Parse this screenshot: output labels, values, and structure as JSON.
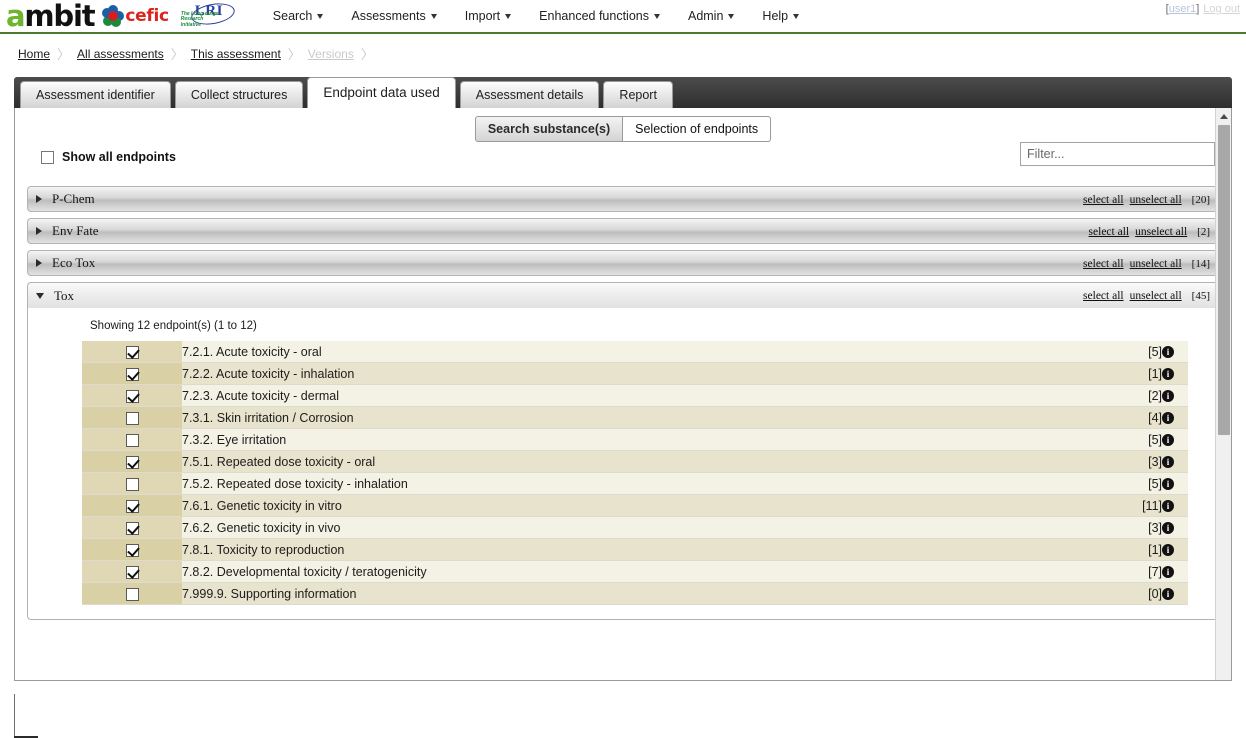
{
  "header": {
    "logo": {
      "brand": "ambit",
      "brand_first_letter": "a",
      "partner1": "cefic",
      "partner2": "LRI",
      "partner2_sub": "The Long-range Research Initiative"
    },
    "nav": [
      {
        "label": "Search",
        "has_caret": true
      },
      {
        "label": "Assessments",
        "has_caret": true
      },
      {
        "label": "Import",
        "has_caret": true
      },
      {
        "label": "Enhanced functions",
        "has_caret": true
      },
      {
        "label": "Admin",
        "has_caret": true
      },
      {
        "label": "Help",
        "has_caret": true
      }
    ],
    "user": {
      "bracket_open": "[",
      "name": "user1",
      "bracket_close": "]",
      "logout": "Log out"
    }
  },
  "breadcrumb": {
    "items": [
      {
        "label": "Home",
        "dim": false
      },
      {
        "label": "All assessments",
        "dim": false
      },
      {
        "label": "This assessment",
        "dim": false
      },
      {
        "label": "Versions",
        "dim": true
      }
    ],
    "separator": "〉"
  },
  "tabs": [
    {
      "label": "Assessment identifier",
      "active": false
    },
    {
      "label": "Collect structures",
      "active": false
    },
    {
      "label": "Endpoint data used",
      "active": true
    },
    {
      "label": "Assessment details",
      "active": false
    },
    {
      "label": "Report",
      "active": false
    }
  ],
  "subtabs": [
    {
      "label": "Search substance(s)",
      "active": false
    },
    {
      "label": "Selection of endpoints",
      "active": true
    }
  ],
  "controls": {
    "show_all_label": "Show all endpoints",
    "show_all_checked": false,
    "filter_placeholder": "Filter...",
    "filter_value": ""
  },
  "accordion_links": {
    "select_all": "select all",
    "unselect_all": "unselect all"
  },
  "accordions": [
    {
      "title": "P-Chem",
      "count": "[20]",
      "open": false
    },
    {
      "title": "Env Fate",
      "count": "[2]",
      "open": false
    },
    {
      "title": "Eco Tox",
      "count": "[14]",
      "open": false
    },
    {
      "title": "Tox",
      "count": "[45]",
      "open": true
    }
  ],
  "tox_panel": {
    "showing": "Showing 12 endpoint(s) (1 to 12)",
    "info_icon_glyph": "i",
    "rows": [
      {
        "checked": true,
        "label": "7.2.1. Acute toxicity - oral",
        "count": "[5]"
      },
      {
        "checked": true,
        "label": "7.2.2. Acute toxicity - inhalation",
        "count": "[1]"
      },
      {
        "checked": true,
        "label": "7.2.3. Acute toxicity - dermal",
        "count": "[2]"
      },
      {
        "checked": false,
        "label": "7.3.1. Skin irritation / Corrosion",
        "count": "[4]"
      },
      {
        "checked": false,
        "label": "7.3.2. Eye irritation",
        "count": "[5]"
      },
      {
        "checked": true,
        "label": "7.5.1. Repeated dose toxicity - oral",
        "count": "[3]"
      },
      {
        "checked": false,
        "label": "7.5.2. Repeated dose toxicity - inhalation",
        "count": "[5]"
      },
      {
        "checked": true,
        "label": "7.6.1. Genetic toxicity in vitro",
        "count": "[11]"
      },
      {
        "checked": true,
        "label": "7.6.2. Genetic toxicity in vivo",
        "count": "[3]"
      },
      {
        "checked": true,
        "label": "7.8.1. Toxicity to reproduction",
        "count": "[1]"
      },
      {
        "checked": true,
        "label": "7.8.2. Developmental toxicity / teratogenicity",
        "count": "[7]"
      },
      {
        "checked": false,
        "label": "7.999.9. Supporting information",
        "count": "[0]"
      }
    ]
  },
  "colors": {
    "brand_green": "#6cb52d",
    "header_rule": "#4a7a2f",
    "row_light": "#f4f1e5",
    "row_dark": "#e8e3cd",
    "check_col_light": "#e0d8b4",
    "check_col_dark": "#d9d0a5"
  }
}
